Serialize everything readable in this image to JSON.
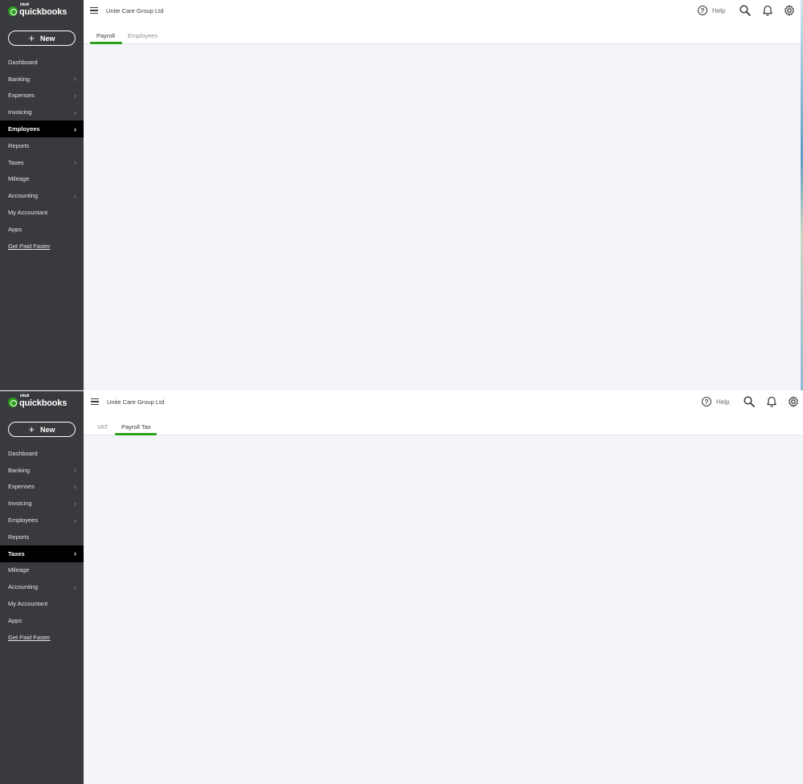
{
  "screens": [
    {
      "brand": {
        "intuit": "intuit",
        "name": "quickbooks"
      },
      "new_button": {
        "label": "New",
        "icon": "plus-icon"
      },
      "company_name": "Unite Care Group Ltd",
      "help_label": "Help",
      "nav": [
        {
          "label": "Dashboard",
          "chevron": false,
          "active": false
        },
        {
          "label": "Banking",
          "chevron": true,
          "active": false
        },
        {
          "label": "Expenses",
          "chevron": true,
          "active": false
        },
        {
          "label": "Invoicing",
          "chevron": true,
          "active": false
        },
        {
          "label": "Employees",
          "chevron": true,
          "active": true
        },
        {
          "label": "Reports",
          "chevron": false,
          "active": false
        },
        {
          "label": "Taxes",
          "chevron": true,
          "active": false
        },
        {
          "label": "Mileage",
          "chevron": false,
          "active": false
        },
        {
          "label": "Accounting",
          "chevron": true,
          "active": false
        },
        {
          "label": "My Accountant",
          "chevron": false,
          "active": false
        },
        {
          "label": "Apps",
          "chevron": false,
          "active": false
        }
      ],
      "nav_link": "Get Paid Faster",
      "tabs": [
        {
          "label": "Payroll",
          "active": true
        },
        {
          "label": "Employees",
          "active": false
        }
      ]
    },
    {
      "brand": {
        "intuit": "intuit",
        "name": "quickbooks"
      },
      "new_button": {
        "label": "New",
        "icon": "plus-icon"
      },
      "company_name": "Unite Care Group Ltd",
      "help_label": "Help",
      "nav": [
        {
          "label": "Dashboard",
          "chevron": false,
          "active": false
        },
        {
          "label": "Banking",
          "chevron": true,
          "active": false
        },
        {
          "label": "Expenses",
          "chevron": true,
          "active": false
        },
        {
          "label": "Invoicing",
          "chevron": true,
          "active": false
        },
        {
          "label": "Employees",
          "chevron": true,
          "active": false
        },
        {
          "label": "Reports",
          "chevron": false,
          "active": false
        },
        {
          "label": "Taxes",
          "chevron": true,
          "active": true
        },
        {
          "label": "Mileage",
          "chevron": false,
          "active": false
        },
        {
          "label": "Accounting",
          "chevron": true,
          "active": false
        },
        {
          "label": "My Accountant",
          "chevron": false,
          "active": false
        },
        {
          "label": "Apps",
          "chevron": false,
          "active": false
        }
      ],
      "nav_link": "Get Paid Faster",
      "tabs": [
        {
          "label": "VAT",
          "active": false
        },
        {
          "label": "Payroll Tax",
          "active": true
        }
      ]
    }
  ],
  "icons": {
    "brand": "quickbooks-logo-icon",
    "menu": "hamburger-menu-icon",
    "help": "help-circle-icon",
    "search": "search-icon",
    "notifications": "bell-icon",
    "settings": "gear-icon",
    "chevron": "chevron-right-icon"
  },
  "colors": {
    "sidebar": "#393a3d",
    "active_nav": "#000000",
    "accent": "#2ca01c",
    "content_bg": "#f4f5f8"
  }
}
